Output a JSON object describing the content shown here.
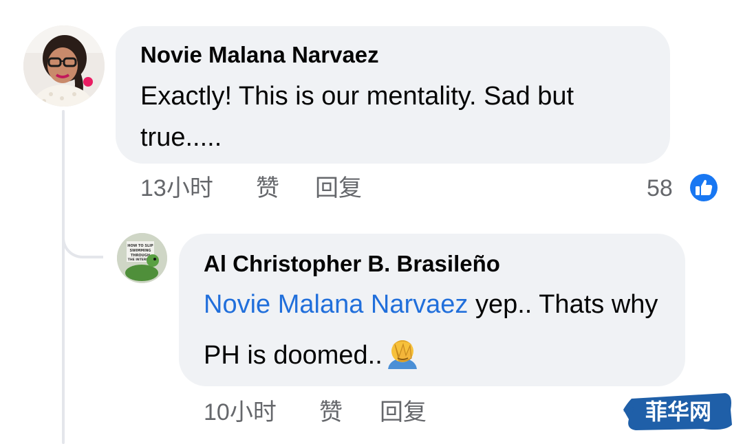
{
  "comment": {
    "author": "Novie Malana Narvaez",
    "text": "Exactly! This is our mentality. Sad but true.....",
    "time": "13小时",
    "like_label": "赞",
    "reply_label": "回复",
    "reaction_count": "58",
    "reaction_icon": "thumbs-up-icon",
    "reaction_color": "#1877f2"
  },
  "reply": {
    "author": "Al Christopher B. Brasileño",
    "mention": "Novie Malana Narvaez",
    "text": " yep.. Thats why PH is doomed..",
    "emoji": "face-palm-emoji",
    "time": "10小时",
    "like_label": "赞",
    "reply_label": "回复",
    "avatar_text": "HOW TO SLIP SWIMMING THROUGH THE INTERNET"
  },
  "watermark": {
    "text": "菲华网"
  },
  "colors": {
    "bubble": "#f0f2f5",
    "mention": "#216fdb",
    "meta": "#65676b",
    "thread_line": "#e4e6eb"
  }
}
